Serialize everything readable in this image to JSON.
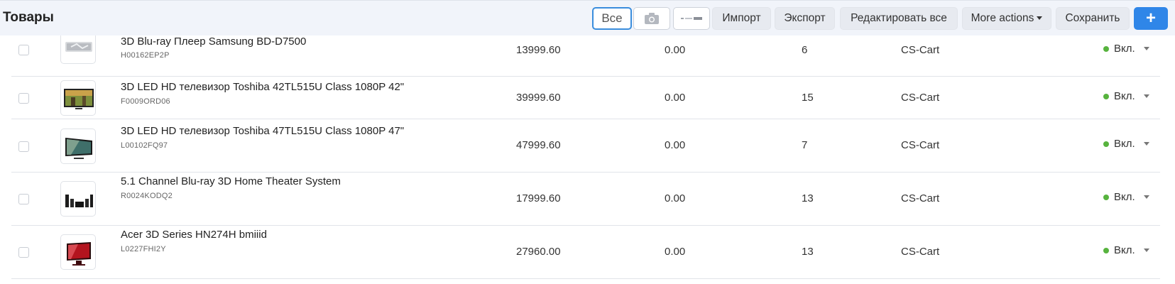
{
  "header": {
    "title": "Товары",
    "buttons": {
      "all": "Все",
      "import": "Импорт",
      "export": "Экспорт",
      "edit_all": "Редактировать все",
      "more_actions": "More actions",
      "save": "Сохранить",
      "add": "+"
    }
  },
  "colors": {
    "accent": "#2f86e8",
    "status_active": "#57b33e",
    "header_bg": "#f1f4fa"
  },
  "products": [
    {
      "name": "3D Blu-ray Плеер  Samsung BD-D7500",
      "code": "H00162EP2P",
      "price": "13999.60",
      "list_price": "0.00",
      "quantity": "6",
      "vendor": "CS-Cart",
      "status": "Вкл."
    },
    {
      "name": "3D LED HD телевизор Toshiba 42TL515U Class 1080P 42\"",
      "code": "F0009ORD06",
      "price": "39999.60",
      "list_price": "0.00",
      "quantity": "15",
      "vendor": "CS-Cart",
      "status": "Вкл."
    },
    {
      "name": "3D LED HD телевизор Toshiba 47TL515U Class 1080P 47\"",
      "code": "L00102FQ97",
      "price": "47999.60",
      "list_price": "0.00",
      "quantity": "7",
      "vendor": "CS-Cart",
      "status": "Вкл."
    },
    {
      "name": "5.1 Channel Blu-ray 3D Home Theater System",
      "code": "R0024KODQ2",
      "price": "17999.60",
      "list_price": "0.00",
      "quantity": "13",
      "vendor": "CS-Cart",
      "status": "Вкл."
    },
    {
      "name": "Acer 3D Series HN274H bmiiid",
      "code": "L0227FHI2Y",
      "price": "27960.00",
      "list_price": "0.00",
      "quantity": "13",
      "vendor": "CS-Cart",
      "status": "Вкл."
    }
  ]
}
